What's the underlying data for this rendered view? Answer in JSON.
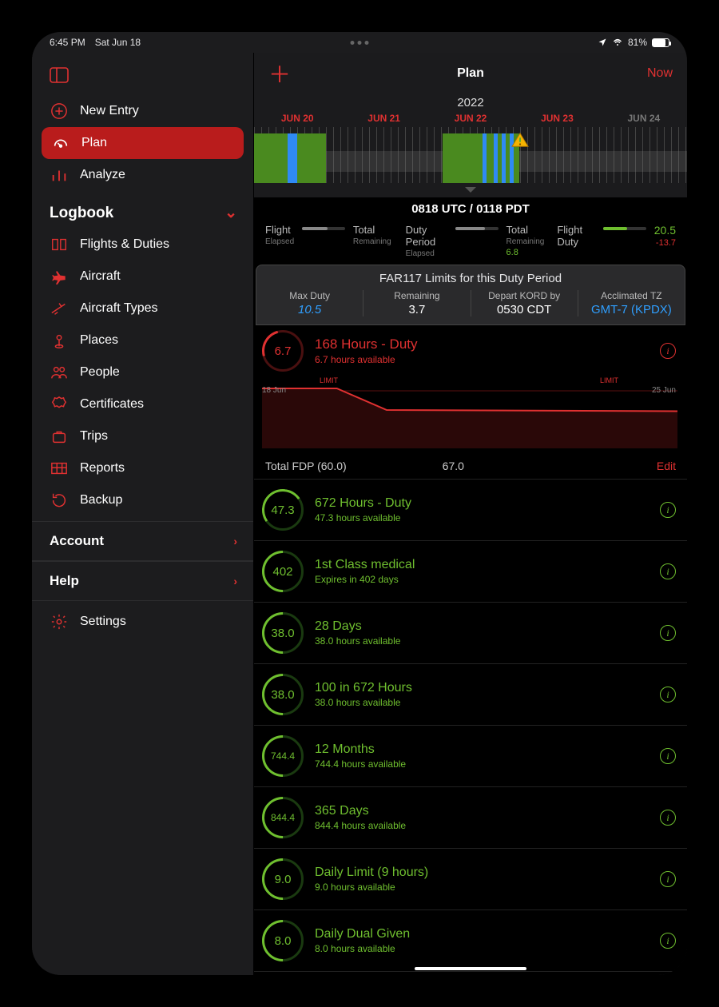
{
  "status": {
    "time": "6:45 PM",
    "date": "Sat Jun 18",
    "battery_pct": "81%"
  },
  "sidebar": {
    "new_entry": "New Entry",
    "plan": "Plan",
    "analyze": "Analyze",
    "logbook_header": "Logbook",
    "items": [
      "Flights & Duties",
      "Aircraft",
      "Aircraft Types",
      "Places",
      "People",
      "Certificates",
      "Trips",
      "Reports",
      "Backup"
    ],
    "account": "Account",
    "help": "Help",
    "settings": "Settings"
  },
  "header": {
    "title": "Plan",
    "now": "Now"
  },
  "timeline": {
    "year": "2022",
    "days": [
      "JUN 20",
      "JUN 21",
      "JUN 22",
      "JUN 23",
      "JUN 24"
    ],
    "utc": "0818 UTC / 0118 PDT"
  },
  "elapsed": {
    "flight_lbl": "Flight",
    "flight_sub": "Elapsed",
    "total_lbl": "Total",
    "total_sub": "Remaining",
    "duty_lbl": "Duty Period",
    "duty_sub": "Elapsed",
    "duty_total_lbl": "Total",
    "duty_total_sub": "Remaining",
    "duty_total_val": "6.8",
    "fdp_lbl": "Flight Duty",
    "fdp_val": "20.5",
    "fdp_sub": "-13.7"
  },
  "far117": {
    "title": "FAR117 Limits for this Duty Period",
    "max_duty_lbl": "Max Duty",
    "max_duty_val": "10.5",
    "remaining_lbl": "Remaining",
    "remaining_val": "3.7",
    "depart_lbl": "Depart KORD by",
    "depart_val": "0530 CDT",
    "tz_lbl": "Acclimated TZ",
    "tz_val": "GMT-7 (KPDX)"
  },
  "duty168": {
    "ring": "6.7",
    "title": "168 Hours - Duty",
    "sub": "6.7 hours available",
    "limit": "LIMIT",
    "start": "18 Jun",
    "end": "25 Jun"
  },
  "chart_data": {
    "type": "line",
    "title": "168 Hours - Duty usage",
    "x": [
      0,
      0.18,
      0.3,
      1.0
    ],
    "values": [
      100,
      100,
      64,
      62
    ],
    "ylim": [
      0,
      120
    ],
    "xlabel_start": "18 Jun",
    "xlabel_end": "25 Jun",
    "limit_line": 100
  },
  "fdp": {
    "label": "Total FDP (60.0)",
    "val": "67.0",
    "edit": "Edit"
  },
  "limits": [
    {
      "ring": "47.3",
      "title": "672 Hours - Duty",
      "sub": "47.3 hours available",
      "arc": "mid"
    },
    {
      "ring": "402",
      "title": "1st Class medical",
      "sub": "Expires in 402 days",
      "arc": "full"
    },
    {
      "ring": "38.0",
      "title": "28 Days",
      "sub": "38.0 hours available",
      "arc": "full"
    },
    {
      "ring": "38.0",
      "title": "100 in 672 Hours",
      "sub": "38.0 hours available",
      "arc": "full"
    },
    {
      "ring": "744.4",
      "title": "12 Months",
      "sub": "744.4 hours available",
      "arc": "full"
    },
    {
      "ring": "844.4",
      "title": "365 Days",
      "sub": "844.4 hours available",
      "arc": "full"
    },
    {
      "ring": "9.0",
      "title": "Daily Limit (9 hours)",
      "sub": "9.0 hours available",
      "arc": "full"
    },
    {
      "ring": "8.0",
      "title": "Daily Dual Given",
      "sub": "8.0 hours available",
      "arc": "full"
    }
  ]
}
